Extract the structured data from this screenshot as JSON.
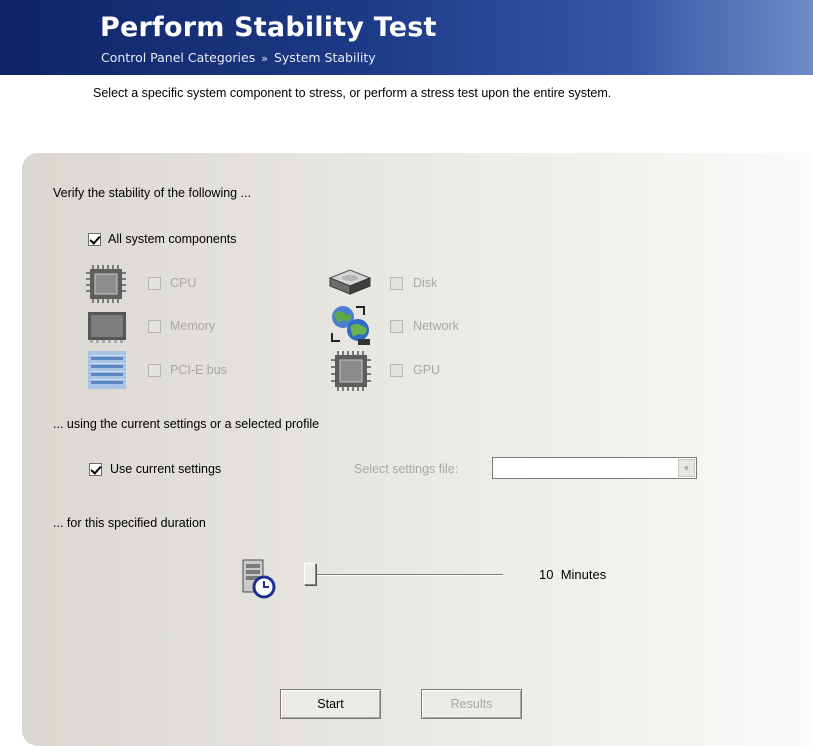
{
  "header": {
    "title": "Perform Stability Test",
    "breadcrumb": [
      "Control Panel Categories",
      "System Stability"
    ],
    "breadcrumb_separator": "»"
  },
  "subtitle": "Select a specific system component to stress, or perform a stress test upon the entire system.",
  "components": {
    "heading": "Verify the stability of the following ...",
    "all": {
      "label": "All system components",
      "checked": true
    },
    "items": [
      {
        "label": "CPU",
        "icon": "cpu-icon",
        "checked": false,
        "enabled": false
      },
      {
        "label": "Disk",
        "icon": "disk-icon",
        "checked": false,
        "enabled": false
      },
      {
        "label": "Memory",
        "icon": "memory-icon",
        "checked": false,
        "enabled": false
      },
      {
        "label": "Network",
        "icon": "network-icon",
        "checked": false,
        "enabled": false
      },
      {
        "label": "PCI-E bus",
        "icon": "pcie-bus-icon",
        "checked": false,
        "enabled": false
      },
      {
        "label": "GPU",
        "icon": "gpu-icon",
        "checked": false,
        "enabled": false
      }
    ]
  },
  "settings": {
    "heading": "... using the current settings or a selected profile",
    "use_current": {
      "label": "Use current settings",
      "checked": true
    },
    "file_label": "Select settings file:",
    "file_value": ""
  },
  "duration": {
    "heading": "... for this specified duration",
    "icon": "timer-icon",
    "value": 10,
    "unit": "Minutes",
    "display": "10  Minutes"
  },
  "buttons": {
    "start": "Start",
    "results": "Results"
  },
  "colors": {
    "header_dark": "#0f2466",
    "header_light": "#6f8bc9",
    "disabled_text": "#a9a7a3"
  }
}
